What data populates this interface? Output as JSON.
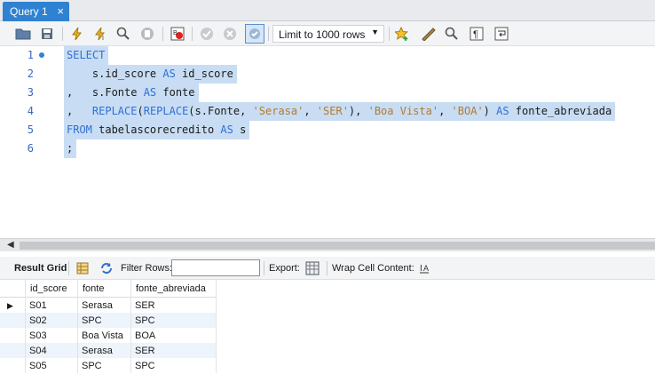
{
  "tab": {
    "label": "Query 1",
    "close": "×"
  },
  "toolbar": {
    "limit_value": "Limit to 1000 rows",
    "icons": [
      "open-folder-icon",
      "save-icon",
      "execute-icon",
      "execute-statement-icon",
      "explain-icon",
      "stop-icon",
      "toggle-error-stop-icon",
      "commit-icon",
      "rollback-icon",
      "autocommit-icon",
      "limit-dropdown",
      "add-snippet-icon",
      "beautify-icon",
      "find-icon",
      "invisible-chars-icon",
      "word-wrap-icon"
    ]
  },
  "editor": {
    "lines": [
      {
        "num": "1",
        "parts": [
          {
            "t": "SELECT",
            "c": "kw"
          }
        ]
      },
      {
        "num": "2",
        "parts": [
          {
            "t": "    s.id_score ",
            "c": ""
          },
          {
            "t": "AS",
            "c": "kw"
          },
          {
            "t": " id_score",
            "c": ""
          }
        ]
      },
      {
        "num": "3",
        "parts": [
          {
            "t": ",   s.Fonte ",
            "c": ""
          },
          {
            "t": "AS",
            "c": "kw"
          },
          {
            "t": " fonte",
            "c": ""
          }
        ]
      },
      {
        "num": "4",
        "parts": [
          {
            "t": ",   ",
            "c": ""
          },
          {
            "t": "REPLACE",
            "c": "kw"
          },
          {
            "t": "(",
            "c": ""
          },
          {
            "t": "REPLACE",
            "c": "kw"
          },
          {
            "t": "(s.Fonte, ",
            "c": ""
          },
          {
            "t": "'Serasa'",
            "c": "str"
          },
          {
            "t": ", ",
            "c": ""
          },
          {
            "t": "'SER'",
            "c": "str"
          },
          {
            "t": "), ",
            "c": ""
          },
          {
            "t": "'Boa Vista'",
            "c": "str"
          },
          {
            "t": ", ",
            "c": ""
          },
          {
            "t": "'BOA'",
            "c": "str"
          },
          {
            "t": ") ",
            "c": ""
          },
          {
            "t": "AS",
            "c": "kw"
          },
          {
            "t": " fonte_abreviada",
            "c": ""
          }
        ]
      },
      {
        "num": "5",
        "parts": [
          {
            "t": "FROM",
            "c": "kw"
          },
          {
            "t": " tabelascorecredito ",
            "c": ""
          },
          {
            "t": "AS",
            "c": "kw"
          },
          {
            "t": " s",
            "c": ""
          }
        ]
      },
      {
        "num": "6",
        "parts": [
          {
            "t": ";",
            "c": ""
          }
        ]
      }
    ]
  },
  "results": {
    "result_grid_label": "Result Grid",
    "filter_label": "Filter Rows:",
    "filter_value": "",
    "export_label": "Export:",
    "wrap_label": "Wrap Cell Content:",
    "columns": [
      "id_score",
      "fonte",
      "fonte_abreviada"
    ],
    "rows": [
      [
        "S01",
        "Serasa",
        "SER"
      ],
      [
        "S02",
        "SPC",
        "SPC"
      ],
      [
        "S03",
        "Boa Vista",
        "BOA"
      ],
      [
        "S04",
        "Serasa",
        "SER"
      ],
      [
        "S05",
        "SPC",
        "SPC"
      ]
    ]
  }
}
